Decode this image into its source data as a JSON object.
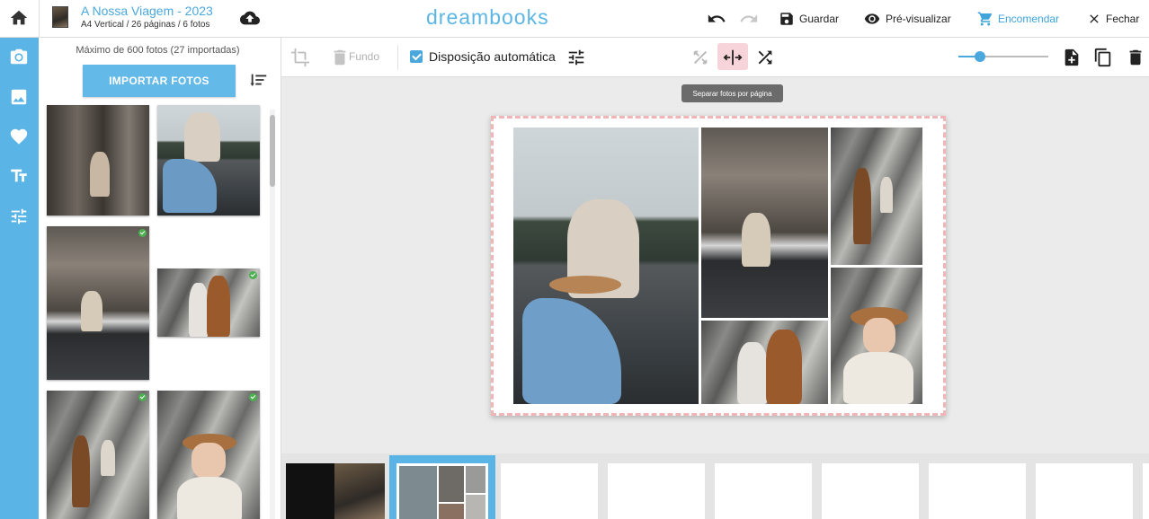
{
  "header": {
    "project_title": "A Nossa Viagem - 2023",
    "project_subtitle": "A4 Vertical / 26 páginas / 6 fotos",
    "logo": "dreambooks",
    "save_label": "Guardar",
    "preview_label": "Pré-visualizar",
    "order_label": "Encomendar",
    "close_label": "Fechar",
    "colors": {
      "accent": "#4aa8dd",
      "rail": "#5ab4e5"
    }
  },
  "sidebar": {
    "rail_icons": [
      "camera-icon",
      "image-icon",
      "heart-icon",
      "text-icon",
      "sliders-icon"
    ],
    "max_photos_text": "Máximo de 600 fotos (27 importadas)",
    "import_label": "IMPORTAR FOTOS",
    "photos": [
      {
        "name": "photo-rock-cliff",
        "used": false
      },
      {
        "name": "photo-woman-boat",
        "used": false
      },
      {
        "name": "photo-woman-boat-rock",
        "used": true
      },
      {
        "name": "photo-couple-hat",
        "used": true
      },
      {
        "name": "photo-couple-rocks",
        "used": true
      },
      {
        "name": "photo-woman-hat",
        "used": true
      }
    ]
  },
  "editor": {
    "fundo_label": "Fundo",
    "auto_layout_label": "Disposição automática",
    "auto_layout_checked": true,
    "tooltip": "Separar fotos por página",
    "zoom_level": 0.24
  },
  "pages": {
    "selected_index": 1,
    "count_visible": 9
  }
}
